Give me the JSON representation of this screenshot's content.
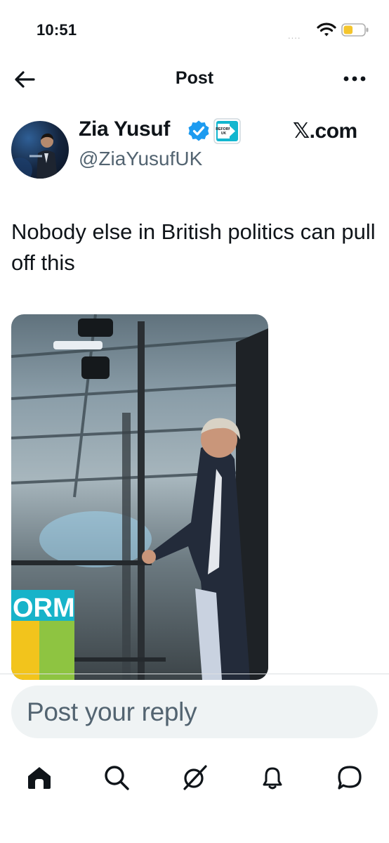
{
  "status_bar": {
    "time": "10:51",
    "signal": "....",
    "battery_level": 0.45,
    "battery_color": "#f4c52d"
  },
  "header": {
    "title": "Post"
  },
  "tweet": {
    "author": {
      "display_name": "Zia Yusuf",
      "handle": "@ZiaYusufUK",
      "verified_color": "#1d9bf0",
      "affiliate_badge_text": "REFORM UK"
    },
    "source_label": "𝕏.com",
    "text": "Nobody else in British politics can pull off this",
    "media": {
      "sign_text": "ORM"
    }
  },
  "reply": {
    "placeholder": "Post your reply"
  },
  "tabs": [
    {
      "icon": "home-icon"
    },
    {
      "icon": "search-icon"
    },
    {
      "icon": "grok-icon"
    },
    {
      "icon": "notifications-icon"
    },
    {
      "icon": "messages-icon"
    }
  ],
  "colors": {
    "text": "#0f1419",
    "secondary": "#536471",
    "accent": "#1d9bf0",
    "reply_bg": "#eff3f4"
  }
}
